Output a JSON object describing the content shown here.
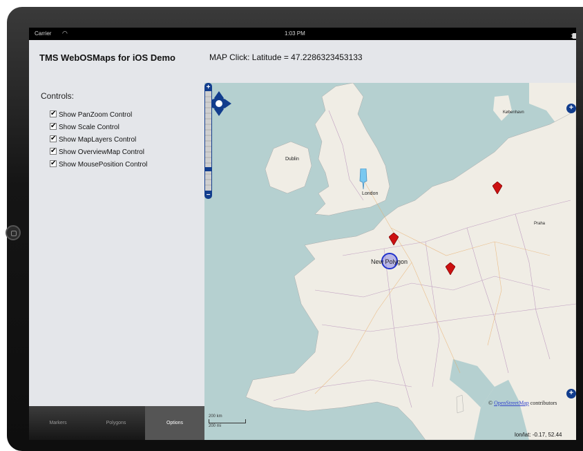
{
  "status": {
    "carrier": "Carrier",
    "time": "1:03 PM",
    "battery": "100%"
  },
  "app": {
    "title": "TMS WebOSMaps for iOS Demo",
    "click_info": "MAP Click: Latitude = 47.2286323453133"
  },
  "controls": {
    "title": "Controls:",
    "items": [
      {
        "label": "Show PanZoom Control",
        "checked": true
      },
      {
        "label": "Show Scale Control",
        "checked": true
      },
      {
        "label": "Show MapLayers Control",
        "checked": true
      },
      {
        "label": "Show OverviewMap Control",
        "checked": true
      },
      {
        "label": "Show MousePosition Control",
        "checked": true
      }
    ]
  },
  "tabs": [
    {
      "label": "Markers",
      "active": false
    },
    {
      "label": "Polygons",
      "active": false
    },
    {
      "label": "Options",
      "active": true
    }
  ],
  "map": {
    "cities": {
      "london": "London",
      "dublin": "Dublin",
      "kobenhavn": "København",
      "praha": "Praha"
    },
    "polygon_label": "New Polygon",
    "scale": {
      "top": "200 km",
      "bottom": "200 mi"
    },
    "attribution": {
      "prefix": "©",
      "link": "OpenStreetMap",
      "suffix": "contributors"
    },
    "mouse_position": "lon/lat: -0.17, 52.44",
    "colors": {
      "sea": "#b5d0d0",
      "land": "#f0ede5",
      "marker": "#cc1111",
      "panzoom": "#123d8d"
    }
  }
}
